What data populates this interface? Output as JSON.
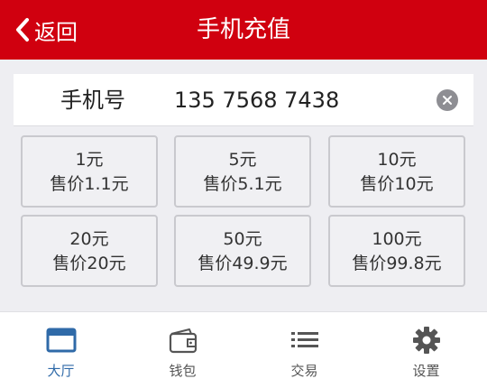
{
  "header": {
    "back_label": "返回",
    "title": "手机充值"
  },
  "phone": {
    "label": "手机号",
    "value": "135 7568 7438"
  },
  "options": [
    {
      "amount": "1元",
      "price": "售价1.1元"
    },
    {
      "amount": "5元",
      "price": "售价5.1元"
    },
    {
      "amount": "10元",
      "price": "售价10元"
    },
    {
      "amount": "20元",
      "price": "售价20元"
    },
    {
      "amount": "50元",
      "price": "售价49.9元"
    },
    {
      "amount": "100元",
      "price": "售价99.8元"
    }
  ],
  "tabs": [
    {
      "label": "大厅",
      "icon": "lobby-icon",
      "active": true
    },
    {
      "label": "钱包",
      "icon": "wallet-icon",
      "active": false
    },
    {
      "label": "交易",
      "icon": "list-icon",
      "active": false
    },
    {
      "label": "设置",
      "icon": "gear-icon",
      "active": false
    }
  ],
  "colors": {
    "header": "#d0000f",
    "active_tab": "#2f6aa8",
    "inactive_tab": "#555555"
  }
}
